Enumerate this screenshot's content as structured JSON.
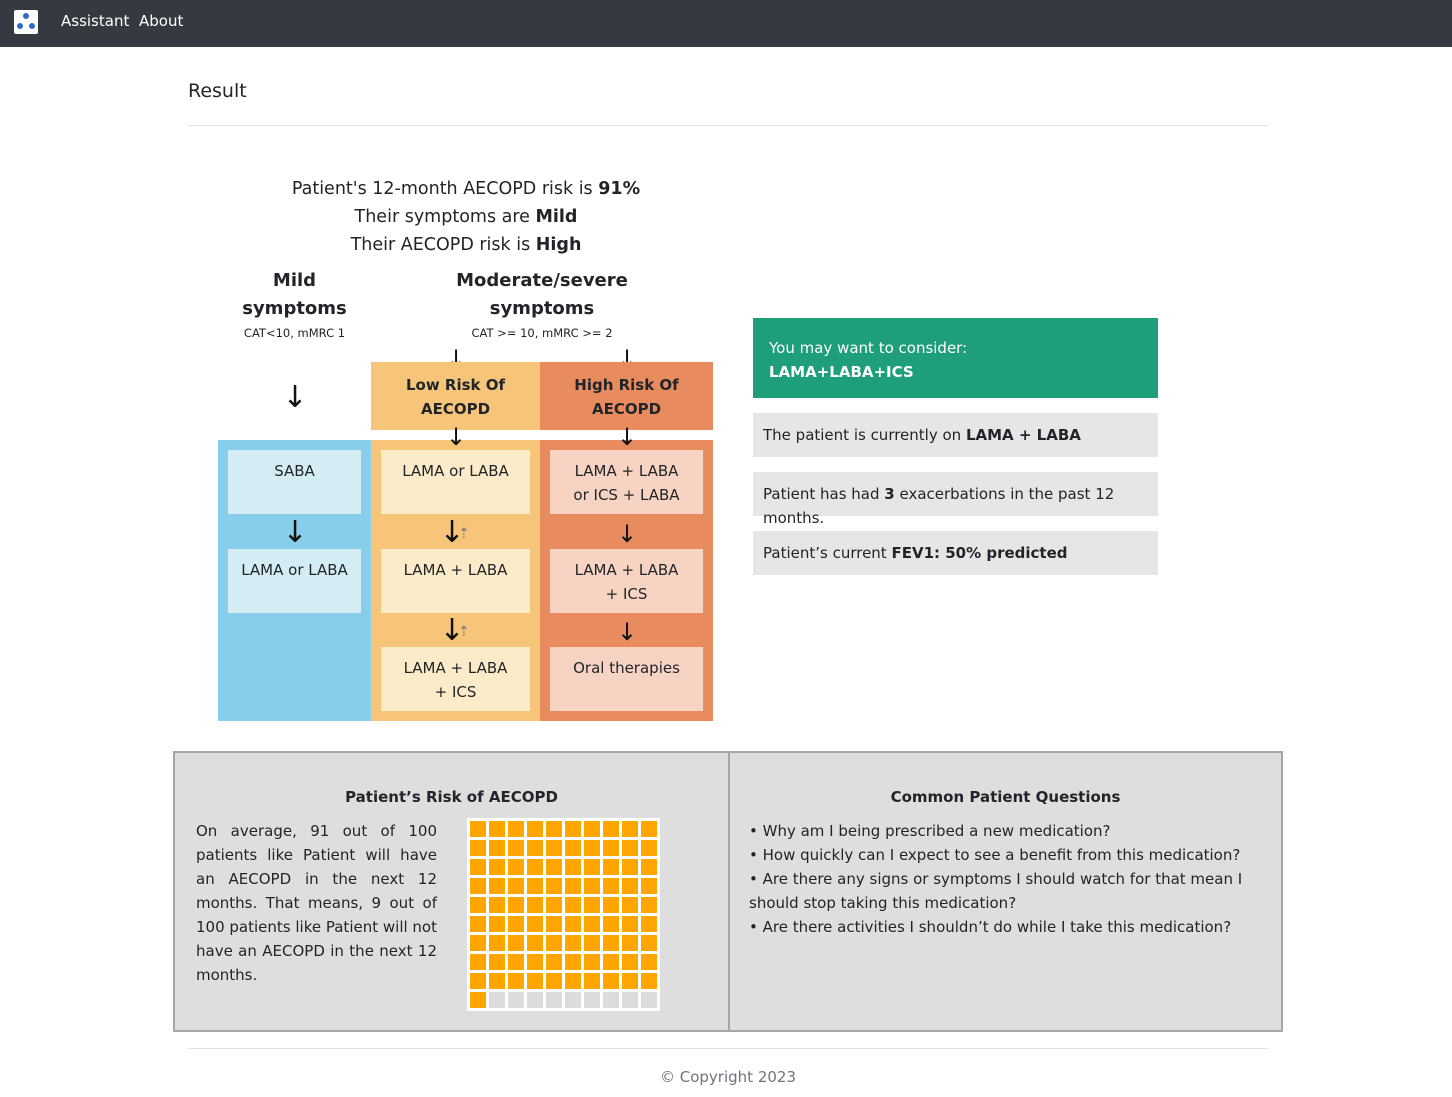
{
  "nav": {
    "links": [
      "Assistant",
      "About"
    ]
  },
  "page": {
    "title": "Result"
  },
  "summary": {
    "risk_prefix": "Patient's 12-month AECOPD risk is ",
    "risk_value": "91%",
    "symptoms_prefix": "Their symptoms are ",
    "symptoms_value": "Mild",
    "aecopd_prefix": "Their AECOPD risk is ",
    "aecopd_value": "High"
  },
  "flowchart": {
    "mild": {
      "heading_line1": "Mild",
      "heading_line2": "symptoms",
      "criteria": "CAT<10, mMRC 1",
      "color": "#87ceeb",
      "box_color": "#d4edf5",
      "boxes": [
        "SABA",
        "LAMA or LABA"
      ]
    },
    "moderate": {
      "heading_line1": "Moderate/severe",
      "heading_line2": "symptoms",
      "criteria": "CAT >= 10, mMRC >= 2"
    },
    "low_risk": {
      "label_line1": "Low Risk Of",
      "label_line2": "AECOPD",
      "color": "#f7c579",
      "box_color": "#fcebc9",
      "boxes": [
        {
          "line1": "LAMA or LABA",
          "line2": ""
        },
        {
          "line1": "LAMA + LABA",
          "line2": ""
        },
        {
          "line1": "LAMA + LABA",
          "line2": "+ ICS"
        }
      ]
    },
    "high_risk": {
      "label_line1": "High Risk Of",
      "label_line2": "AECOPD",
      "color": "#e88c5f",
      "box_color": "#f7d3c4",
      "boxes": [
        {
          "line1": "LAMA + LABA",
          "line2": "or ICS + LABA"
        },
        {
          "line1": "LAMA + LABA",
          "line2": "+ ICS"
        },
        {
          "line1": "Oral therapies",
          "line2": ""
        }
      ]
    }
  },
  "recommendation": {
    "intro": "You may want to consider:",
    "value": "LAMA+LABA+ICS",
    "color": "#1e9e7a"
  },
  "patient_info": {
    "current_prefix": "The patient is currently on ",
    "current_value": "LAMA + LABA",
    "exac_prefix": "Patient has had ",
    "exac_value": "3",
    "exac_suffix": " exacerbations in the past 12 months.",
    "fev1_prefix": "Patient’s current ",
    "fev1_value": "FEV1: 50% predicted"
  },
  "risk_panel": {
    "title": "Patient’s Risk of AECOPD",
    "text": "On average, 91 out of 100 patients like Patient will have an AECOPD in the next 12 months. That means, 9 out of 100 patients like Patient will not have an AECOPD in the next 12 months.",
    "waffle_filled": 91,
    "waffle_total": 100,
    "filled_color": "#ffa500",
    "empty_color": "#dcdcdc"
  },
  "questions_panel": {
    "title": "Common Patient Questions",
    "items": [
      "• Why am I being prescribed a new medication?",
      "• How quickly can I expect to see a benefit from this medication?",
      "• Are there any signs or symptoms I should watch for that mean I should stop taking this medication?",
      "• Are there activities I shouldn’t do while I take this medication?"
    ]
  },
  "footer": {
    "text": "© Copyright 2023"
  }
}
